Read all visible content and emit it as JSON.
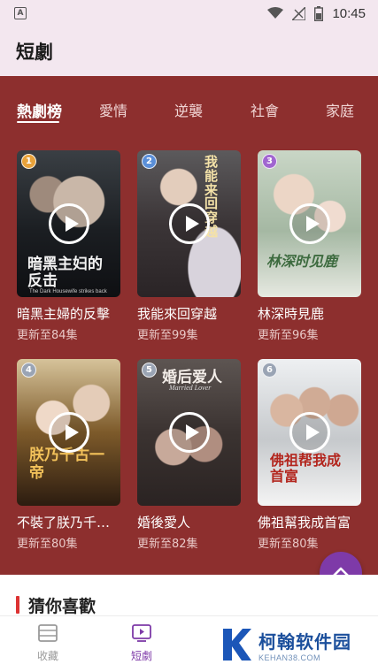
{
  "status_bar": {
    "time": "10:45",
    "notification_icon": "a-icon",
    "icons": [
      "wifi-icon",
      "signal-icon",
      "battery-icon"
    ]
  },
  "header": {
    "title": "短劇"
  },
  "tabs": [
    {
      "label": "熱劇榜",
      "active": true
    },
    {
      "label": "愛情",
      "active": false
    },
    {
      "label": "逆襲",
      "active": false
    },
    {
      "label": "社會",
      "active": false
    },
    {
      "label": "家庭",
      "active": false
    }
  ],
  "dramas": [
    {
      "rank": "1",
      "title": "暗黑主婦的反擊",
      "subtitle": "更新至84集",
      "poster_text": "暗黑主妇的反击",
      "poster_caption": "The Dark Housewife strikes back",
      "badge_color": "#e8a23a"
    },
    {
      "rank": "2",
      "title": "我能來回穿越",
      "subtitle": "更新至99集",
      "poster_text": "我能来回穿越",
      "poster_caption": "",
      "badge_color": "#5a8fd8"
    },
    {
      "rank": "3",
      "title": "林深時見鹿",
      "subtitle": "更新至96集",
      "poster_text": "林深时见鹿",
      "poster_caption": "",
      "badge_color": "#a066d0"
    },
    {
      "rank": "4",
      "title": "不裝了朕乃千古一帝",
      "subtitle": "更新至80集",
      "poster_text": "朕乃千古一帝",
      "poster_caption": "",
      "badge_color": "#9aa4b4"
    },
    {
      "rank": "5",
      "title": "婚後愛人",
      "subtitle": "更新至82集",
      "poster_text": "婚后爱人",
      "poster_caption": "Married Lover",
      "badge_color": "#9aa4b4"
    },
    {
      "rank": "6",
      "title": "佛祖幫我成首富",
      "subtitle": "更新至80集",
      "poster_text": "佛祖帮我成首富",
      "poster_caption": "",
      "badge_color": "#9aa4b4"
    }
  ],
  "section": {
    "title": "猜你喜歡"
  },
  "bottom_nav": [
    {
      "label": "收藏",
      "icon": "collection-icon",
      "active": false
    },
    {
      "label": "短劇",
      "icon": "short-drama-icon",
      "active": true
    }
  ],
  "watermark": {
    "main": "柯翰软件园",
    "sub": "KEHAN38.COM"
  },
  "colors": {
    "hero_bg": "#8d2f2e",
    "header_bg": "#f3e7ef",
    "accent": "#7e3aa8",
    "section_bar": "#dd3333"
  }
}
